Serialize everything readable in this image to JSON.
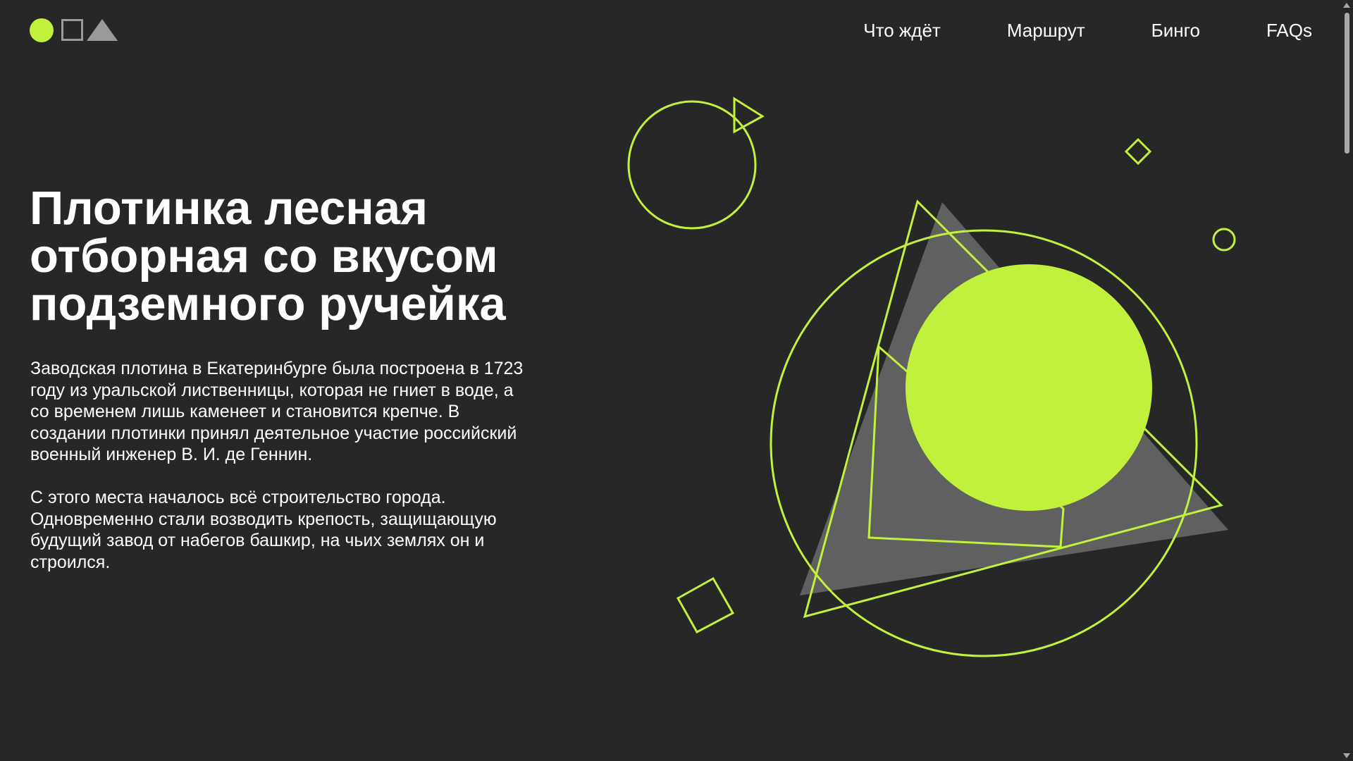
{
  "header": {
    "logo": {
      "icons": [
        "circle-icon",
        "square-icon",
        "triangle-icon"
      ]
    },
    "nav": [
      {
        "label": "Что ждёт"
      },
      {
        "label": "Маршрут"
      },
      {
        "label": "Бинго"
      },
      {
        "label": "FAQs"
      }
    ]
  },
  "hero": {
    "title": "Плотинка лесная отборная со вкусом подземного ручейка",
    "paragraph_1": "Заводская плотина в Екатеринбурге была построена в 1723 году из уральской лиственницы, которая не гниет в воде, а со временем лишь каменеет и становится крепче. В создании плотинки принял деятельное участие российский военный инженер В. И. де Геннин.",
    "paragraph_2": "С этого места началось всё строительство города. Одновременно стали возводить крепость, защищающую будущий завод от набегов башкир, на чьих землях он и строился."
  },
  "colors": {
    "background": "#272727",
    "accent": "#C2F13D",
    "gray_shape": "#606060",
    "logo_gray": "#9A9A9A",
    "text": "#FFFFFF"
  }
}
